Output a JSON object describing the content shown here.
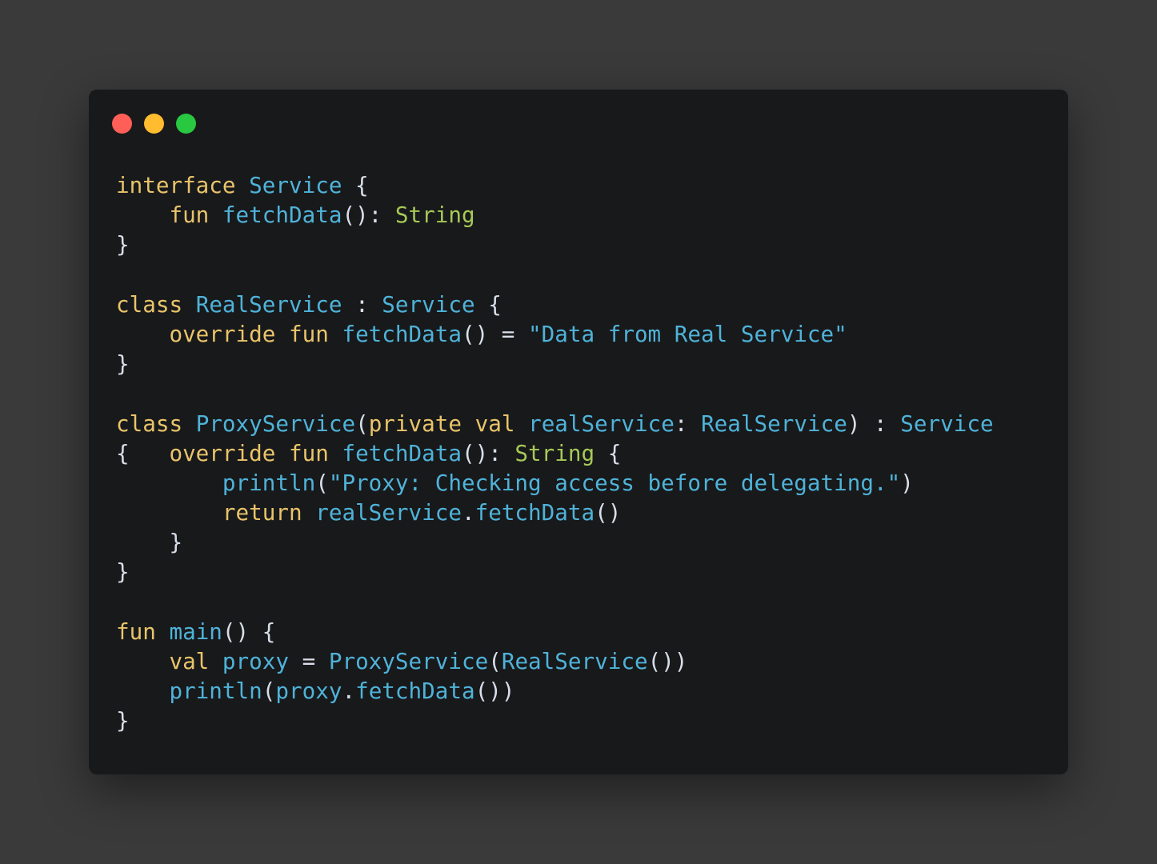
{
  "window": {
    "traffic_lights": {
      "close": {
        "icon": "close-dot-icon",
        "color": "#ff5f57"
      },
      "minimize": {
        "icon": "minimize-dot-icon",
        "color": "#febc2e"
      },
      "maximize": {
        "icon": "maximize-dot-icon",
        "color": "#28c840"
      }
    }
  },
  "colors": {
    "keyword": "#e9c46a",
    "type": "#4fb3d9",
    "builtin_type": "#a7c957",
    "string": "#4fb3d9",
    "punctuation": "#d8dee9",
    "background": "#18191b",
    "page": "#3a3a3a"
  },
  "code": {
    "lines": [
      [
        [
          "kw",
          "interface"
        ],
        [
          "pn",
          " "
        ],
        [
          "tp",
          "Service"
        ],
        [
          "pn",
          " {"
        ]
      ],
      [
        [
          "pn",
          "    "
        ],
        [
          "kw",
          "fun"
        ],
        [
          "pn",
          " "
        ],
        [
          "tp",
          "fetchData"
        ],
        [
          "pn",
          "(): "
        ],
        [
          "ty",
          "String"
        ]
      ],
      [
        [
          "pn",
          "}"
        ]
      ],
      [],
      [
        [
          "kw",
          "class"
        ],
        [
          "pn",
          " "
        ],
        [
          "tp",
          "RealService"
        ],
        [
          "pn",
          " : "
        ],
        [
          "tp",
          "Service"
        ],
        [
          "pn",
          " {"
        ]
      ],
      [
        [
          "pn",
          "    "
        ],
        [
          "kw",
          "override"
        ],
        [
          "pn",
          " "
        ],
        [
          "kw",
          "fun"
        ],
        [
          "pn",
          " "
        ],
        [
          "tp",
          "fetchData"
        ],
        [
          "pn",
          "() = "
        ],
        [
          "st",
          "\"Data from Real Service\""
        ]
      ],
      [
        [
          "pn",
          "}"
        ]
      ],
      [],
      [
        [
          "kw",
          "class"
        ],
        [
          "pn",
          " "
        ],
        [
          "tp",
          "ProxyService"
        ],
        [
          "pn",
          "("
        ],
        [
          "kw",
          "private"
        ],
        [
          "pn",
          " "
        ],
        [
          "kw",
          "val"
        ],
        [
          "pn",
          " "
        ],
        [
          "tp",
          "realService"
        ],
        [
          "pn",
          ": "
        ],
        [
          "tp",
          "RealService"
        ],
        [
          "pn",
          ") : "
        ],
        [
          "tp",
          "Service"
        ]
      ],
      [
        [
          "pn",
          "{   "
        ],
        [
          "kw",
          "override"
        ],
        [
          "pn",
          " "
        ],
        [
          "kw",
          "fun"
        ],
        [
          "pn",
          " "
        ],
        [
          "tp",
          "fetchData"
        ],
        [
          "pn",
          "(): "
        ],
        [
          "ty",
          "String"
        ],
        [
          "pn",
          " {"
        ]
      ],
      [
        [
          "pn",
          "        "
        ],
        [
          "tp",
          "println"
        ],
        [
          "pn",
          "("
        ],
        [
          "st",
          "\"Proxy: Checking access before delegating.\""
        ],
        [
          "pn",
          ")"
        ]
      ],
      [
        [
          "pn",
          "        "
        ],
        [
          "kw",
          "return"
        ],
        [
          "pn",
          " "
        ],
        [
          "tp",
          "realService"
        ],
        [
          "pn",
          "."
        ],
        [
          "tp",
          "fetchData"
        ],
        [
          "pn",
          "()"
        ]
      ],
      [
        [
          "pn",
          "    }"
        ]
      ],
      [
        [
          "pn",
          "}"
        ]
      ],
      [],
      [
        [
          "kw",
          "fun"
        ],
        [
          "pn",
          " "
        ],
        [
          "tp",
          "main"
        ],
        [
          "pn",
          "() {"
        ]
      ],
      [
        [
          "pn",
          "    "
        ],
        [
          "kw",
          "val"
        ],
        [
          "pn",
          " "
        ],
        [
          "tp",
          "proxy"
        ],
        [
          "pn",
          " = "
        ],
        [
          "tp",
          "ProxyService"
        ],
        [
          "pn",
          "("
        ],
        [
          "tp",
          "RealService"
        ],
        [
          "pn",
          "())"
        ]
      ],
      [
        [
          "pn",
          "    "
        ],
        [
          "tp",
          "println"
        ],
        [
          "pn",
          "("
        ],
        [
          "tp",
          "proxy"
        ],
        [
          "pn",
          "."
        ],
        [
          "tp",
          "fetchData"
        ],
        [
          "pn",
          "())"
        ]
      ],
      [
        [
          "pn",
          "}"
        ]
      ]
    ]
  }
}
